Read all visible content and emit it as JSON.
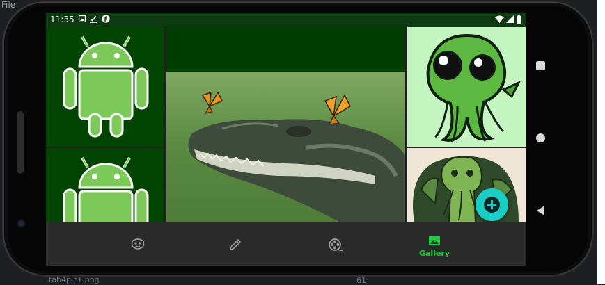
{
  "ide": {
    "menu_file": "File",
    "bottom_file": "tab4pic1.png",
    "bottom_num": "61"
  },
  "status_bar": {
    "time": "11:35",
    "icons": [
      "image-icon",
      "check-icon",
      "f-icon"
    ],
    "right_icons": [
      "wifi-icon",
      "signal-icon",
      "battery-icon"
    ]
  },
  "gallery": {
    "tiles": [
      {
        "name": "android-logo-1",
        "kind": "android"
      },
      {
        "name": "android-logo-2",
        "kind": "android"
      },
      {
        "name": "crocodile-with-butterflies",
        "kind": "photo"
      },
      {
        "name": "cute-cthulhu",
        "kind": "cartoon"
      },
      {
        "name": "cthulhu-drawing",
        "kind": "cartoon"
      }
    ]
  },
  "bottom_nav": {
    "items": [
      {
        "icon": "mask-icon",
        "label": ""
      },
      {
        "icon": "pencil-icon",
        "label": ""
      },
      {
        "icon": "film-reel-icon",
        "label": ""
      },
      {
        "icon": "gallery-icon",
        "label": "Gallery",
        "active": true
      }
    ]
  },
  "fab": {
    "icon": "plus-icon"
  },
  "colors": {
    "accent": "#22c93c",
    "fab": "#19cfc5",
    "android_green": "#7cc95a",
    "nav_bg": "#2b2b2b",
    "status_bg": "#0e3a12"
  }
}
